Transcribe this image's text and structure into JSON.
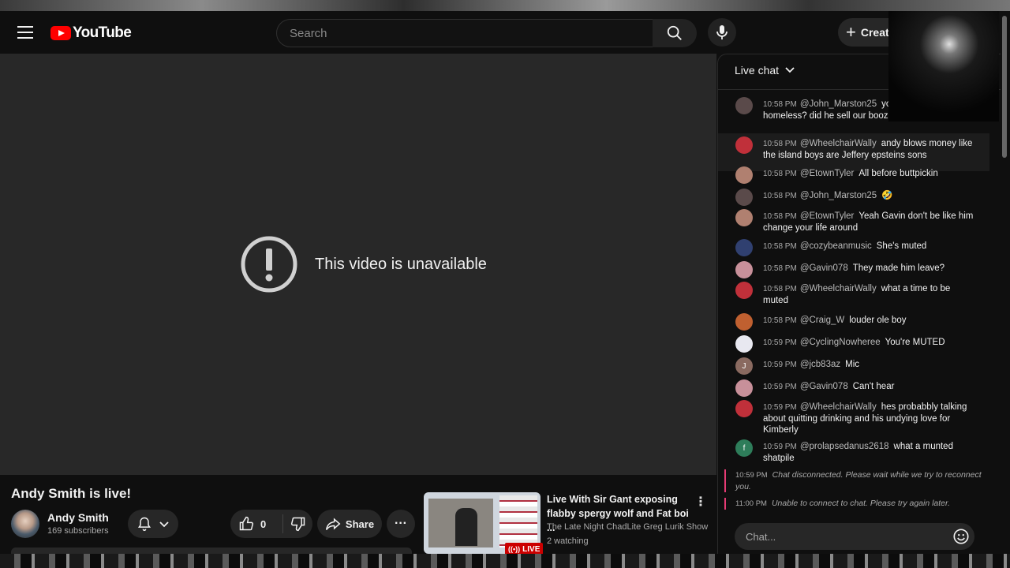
{
  "masthead": {
    "logo_text": "YouTube",
    "search_placeholder": "Search",
    "create_label": "Create"
  },
  "player": {
    "message": "This video is unavailable"
  },
  "video": {
    "title": "Andy Smith is live!",
    "channel": "Andy Smith",
    "subscribers": "169 subscribers",
    "like_count": "0",
    "share_label": "Share"
  },
  "recommendation": {
    "title": "Live With Sir Gant exposing flabby spergy wolf and Fat boi ...",
    "channel": "The Late Night ChadLite Greg Lurik Show",
    "watching": "2 watching",
    "badge": "LIVE"
  },
  "chat": {
    "title": "Live chat",
    "input_placeholder": "Chat...",
    "messages": [
      {
        "time": "10:58 PM",
        "author": "@John_Marston25",
        "text": "you become homeless? did he sell our booze?",
        "avatar_color": "#5a4a4a",
        "initial": ""
      },
      {
        "time": "10:58 PM",
        "author": "@WheelchairWally",
        "text": "andy blows money like the island boys are Jeffery epsteins sons",
        "avatar_color": "#c0303a",
        "initial": ""
      },
      {
        "time": "10:58 PM",
        "author": "@EtownTyler",
        "text": "All before buttpickin",
        "avatar_color": "#b08070",
        "initial": ""
      },
      {
        "time": "10:58 PM",
        "author": "@John_Marston25",
        "text": "🤣",
        "avatar_color": "#5a4a4a",
        "initial": ""
      },
      {
        "time": "10:58 PM",
        "author": "@EtownTyler",
        "text": "Yeah Gavin don't be like him change your life around",
        "avatar_color": "#b08070",
        "initial": ""
      },
      {
        "time": "10:58 PM",
        "author": "@cozybeanmusic",
        "text": "She's muted",
        "avatar_color": "#304070",
        "initial": ""
      },
      {
        "time": "10:58 PM",
        "author": "@Gavin078",
        "text": "They made him leave?",
        "avatar_color": "#c8909a",
        "initial": ""
      },
      {
        "time": "10:58 PM",
        "author": "@WheelchairWally",
        "text": "what a time to be muted",
        "avatar_color": "#c0303a",
        "initial": ""
      },
      {
        "time": "10:58 PM",
        "author": "@Craig_W",
        "text": "louder ole boy",
        "avatar_color": "#c06030",
        "initial": ""
      },
      {
        "time": "10:59 PM",
        "author": "@CyclingNowheree",
        "text": "You're MUTED",
        "avatar_color": "#e8e8f0",
        "initial": ""
      },
      {
        "time": "10:59 PM",
        "author": "@jcb83az",
        "text": "Mic",
        "avatar_color": "#8a6a60",
        "initial": "J"
      },
      {
        "time": "10:59 PM",
        "author": "@Gavin078",
        "text": "Can't hear",
        "avatar_color": "#c8909a",
        "initial": ""
      },
      {
        "time": "10:59 PM",
        "author": "@WheelchairWally",
        "text": "hes probabbly talking about quitting drinking and his undying love for Kimberly",
        "avatar_color": "#c0303a",
        "initial": ""
      },
      {
        "time": "10:59 PM",
        "author": "@prolapsedanus2618",
        "text": "what a munted shatpile",
        "avatar_color": "#2e7d5a",
        "initial": "f"
      }
    ],
    "system": [
      {
        "time": "10:59 PM",
        "text": "Chat disconnected. Please wait while we try to reconnect you."
      },
      {
        "time": "11:00 PM",
        "text": "Unable to connect to chat. Please try again later."
      }
    ]
  }
}
